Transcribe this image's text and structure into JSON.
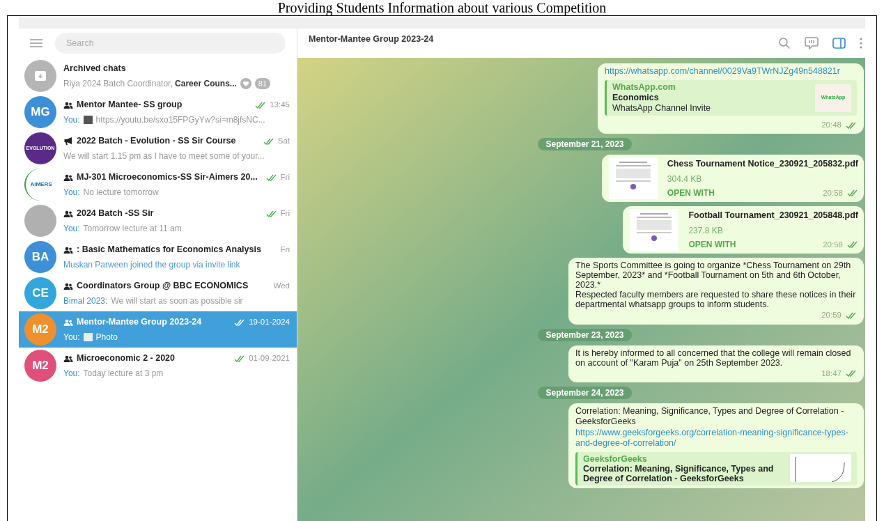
{
  "caption": "Providing Students Information about various Competition",
  "search": {
    "placeholder": "Search"
  },
  "archive": {
    "title": "Archived chats",
    "preview": "Riya 2024 Batch Coordinator, ",
    "preview_bold": "Career Couns...",
    "count": "81"
  },
  "chats": [
    {
      "kind": "group",
      "avatar": {
        "kind": "initials",
        "text": "MG",
        "color": "#3d8fd6"
      },
      "title": "Mentor Mantee- SS group",
      "ticks": true,
      "time": "13:45",
      "sender": "You:",
      "thumb": {
        "kind": "video"
      },
      "preview": "https://youtu.be/sxo15FPGyYw?si=m8jfsNC...",
      "sender_is_preview": false,
      "selected": false
    },
    {
      "kind": "channel",
      "avatar": {
        "kind": "banner",
        "text": "EVOLUTION",
        "color": "#5b2a86"
      },
      "title": "2022 Batch - Evolution - SS Sir Course",
      "ticks": true,
      "time": "Sat",
      "preview": "We will start 1.15 pm as I have to meet some of your...",
      "sender_is_preview": false,
      "selected": false
    },
    {
      "kind": "group",
      "avatar": {
        "kind": "logo",
        "text": "AIMERS",
        "color": "#ffffff"
      },
      "title": "MJ-301 Microeconomics-SS Sir-Aimers 20...",
      "ticks": true,
      "time": "Fri",
      "sender": "You:",
      "preview": "No lecture tomorrow",
      "sender_is_preview": false,
      "selected": false
    },
    {
      "kind": "group",
      "avatar": {
        "kind": "photo",
        "color": "#b0b0b0"
      },
      "title": "2024 Batch -SS Sir",
      "ticks": true,
      "time": "Fri",
      "sender": "You:",
      "preview": "Tomorrow lecture at 11 am",
      "sender_is_preview": false,
      "selected": false
    },
    {
      "kind": "group",
      "avatar": {
        "kind": "initials",
        "text": "BA",
        "color": "#3d8fd6"
      },
      "title": ": Basic Mathematics for Economics Analysis",
      "ticks": false,
      "time": "Fri",
      "preview": "Muskan Parween joined the group via invite link",
      "sender_is_preview": true,
      "selected": false
    },
    {
      "kind": "group",
      "avatar": {
        "kind": "initials",
        "text": "CE",
        "color": "#33a7db"
      },
      "title": "Coordinators Group @ BBC ECONOMICS",
      "ticks": false,
      "time": "Wed",
      "sender": "Bimal 2023:",
      "preview": "We will start as soon as possible sir",
      "sender_is_preview": false,
      "selected": false
    },
    {
      "kind": "group",
      "avatar": {
        "kind": "initials",
        "text": "M2",
        "color": "#f08f2e"
      },
      "title": "Mentor-Mantee Group 2023-24",
      "ticks": true,
      "time": "19-01-2024",
      "sender": "You:",
      "thumb": {
        "kind": "photo"
      },
      "preview": "Photo",
      "sender_is_preview": false,
      "selected": true
    },
    {
      "kind": "group",
      "avatar": {
        "kind": "initials",
        "text": "M2",
        "color": "#e0507a"
      },
      "title": "Microeconomic 2 - 2020",
      "ticks": true,
      "time": "01-09-2021",
      "sender": "You:",
      "preview": "Today lecture at 3 pm",
      "sender_is_preview": false,
      "selected": false
    }
  ],
  "chat_title": "Mentor-Mantee Group 2023-24",
  "messages": [
    {
      "kind": "link_preview",
      "link": "https://whatsapp.com/channel/0029Va9TWrNJZg49n548821r",
      "site": "WhatsApp.com",
      "title": "Economics",
      "desc": "WhatsApp Channel Invite",
      "thumb_text": "WhatsApp",
      "time": "20:48"
    },
    {
      "kind": "date",
      "text": "September 21, 2023"
    },
    {
      "kind": "file",
      "name": "Chess Tournament Notice_230921_205832.pdf",
      "size": "304.4 KB",
      "action": "OPEN WITH",
      "time": "20:58"
    },
    {
      "kind": "file",
      "name": "Football Tournament_230921_205848.pdf",
      "size": "237.8 KB",
      "action": "OPEN WITH",
      "time": "20:58"
    },
    {
      "kind": "text",
      "lines": [
        "The Sports Committee is going to organize *Chess Tournament on 29th September, 2023* and *Football Tournament on 5th and 6th October, 2023.*",
        "Respected faculty members are requested to share these notices in their departmental whatsapp groups to inform students."
      ],
      "time": "20:59"
    },
    {
      "kind": "date",
      "text": "September 23, 2023"
    },
    {
      "kind": "text",
      "lines": [
        "It is hereby informed to all concerned that the college will remain closed on account of \"Karam Puja\" on 25th September 2023."
      ],
      "time": "18:47"
    },
    {
      "kind": "date",
      "text": "September 24, 2023"
    },
    {
      "kind": "article",
      "text": "Correlation: Meaning, Significance, Types and Degree of Correlation - GeeksforGeeks",
      "link": "https://www.geeksforgeeks.org/correlation-meaning-significance-types-and-degree-of-correlation/",
      "site": "GeeksforGeeks",
      "title": "Correlation: Meaning, Significance, Types and Degree of Correlation - GeeksforGeeks"
    }
  ]
}
